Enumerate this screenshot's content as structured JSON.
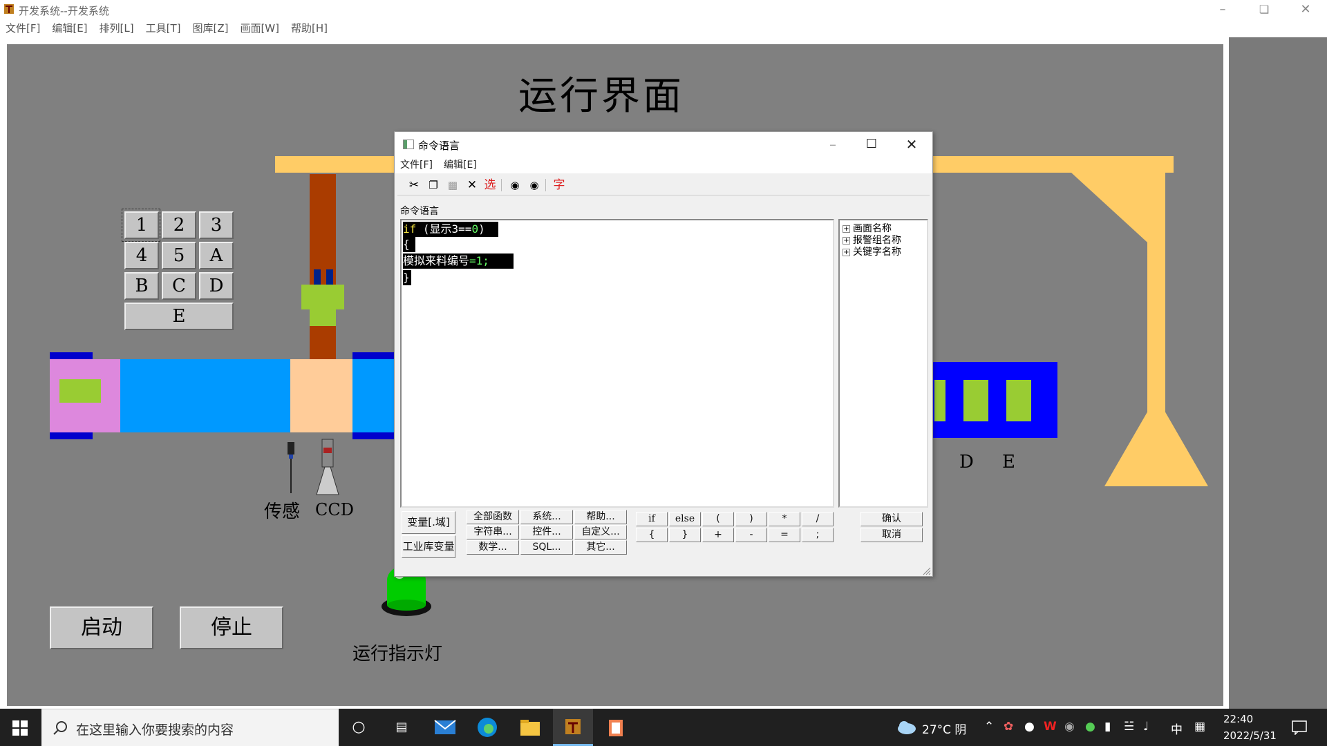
{
  "window": {
    "title": "开发系统--开发系统",
    "menu": [
      "文件[F]",
      "编辑[E]",
      "排列[L]",
      "工具[T]",
      "图库[Z]",
      "画面[W]",
      "帮助[H]"
    ]
  },
  "screen": {
    "title": "运行界面",
    "keypad": [
      "1",
      "2",
      "3",
      "4",
      "5",
      "A",
      "B",
      "C",
      "D",
      "E"
    ],
    "labels": {
      "sensor": "传感",
      "ccd": "CCD",
      "d": "D",
      "e": "E",
      "indicator": "运行指示灯"
    },
    "buttons": {
      "start": "启动",
      "stop": "停止"
    },
    "colors": {
      "conveyor": "#0099ff",
      "frame": "#ffcc66",
      "indicator": "#00cc00",
      "block": "#99cc33",
      "pink": "#dd88dd"
    }
  },
  "dialog": {
    "title": "命令语言",
    "menu": [
      "文件[F]",
      "编辑[E]"
    ],
    "toolbar": {
      "cut": "cut-icon",
      "copy": "copy-icon",
      "paste": "paste-icon",
      "delete": "delete-icon",
      "select": "选",
      "find": "find-icon",
      "replace": "replace-icon",
      "font": "字"
    },
    "section_label": "命令语言",
    "code": {
      "line1_kw": "if",
      "line1_rest": " (显示3==",
      "line1_num": "0",
      "line1_end": ")",
      "line2": "{",
      "line3_var": "模拟来料编号",
      "line3_op": "=",
      "line3_num": "1",
      "line3_end": ";",
      "line4": "}"
    },
    "tree": [
      "画面名称",
      "报警组名称",
      "关键字名称"
    ],
    "buttons": {
      "var": "变量[.域]",
      "lib_var": "工业库变量",
      "all_func": "全部函数",
      "system": "系统...",
      "help": "帮助...",
      "string": "字符串...",
      "control": "控件...",
      "custom": "自定义...",
      "math": "数学...",
      "sql": "SQL...",
      "other": "其它...",
      "ops": [
        "if",
        "else",
        "(",
        ")",
        "*",
        "/",
        "{",
        "}",
        "+",
        "-",
        "=",
        ";"
      ],
      "ok": "确认",
      "cancel": "取消"
    }
  },
  "taskbar": {
    "search_placeholder": "在这里输入你要搜索的内容",
    "weather": "27°C 阴",
    "ime": "中",
    "time": "22:40",
    "date": "2022/5/31"
  }
}
